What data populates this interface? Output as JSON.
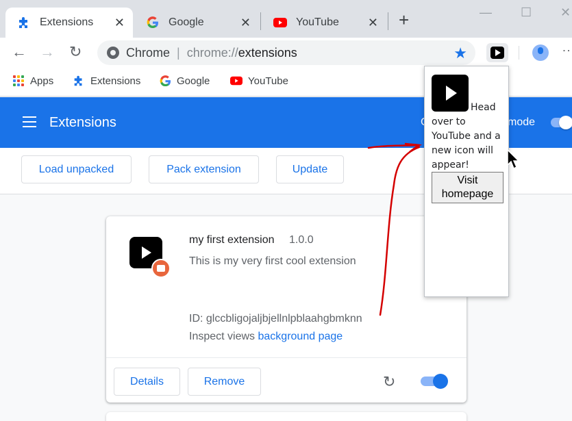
{
  "tabs": [
    {
      "label": "Extensions",
      "icon": "puzzle-icon"
    },
    {
      "label": "Google",
      "icon": "google-icon"
    },
    {
      "label": "YouTube",
      "icon": "youtube-icon"
    }
  ],
  "tab_close": "✕",
  "new_tab": "+",
  "window": {
    "minimize": "—",
    "maximize": "☐",
    "close": "✕"
  },
  "toolbar": {
    "back": "←",
    "forward": "→",
    "reload": "↻",
    "site_label": "Chrome",
    "url_scheme": "chrome://",
    "url_host": "extensions",
    "star": "★",
    "menu": "⋮"
  },
  "bookmarks": [
    {
      "label": "Apps"
    },
    {
      "label": "Extensions"
    },
    {
      "label": "Google"
    },
    {
      "label": "YouTube"
    }
  ],
  "header": {
    "title": "Extensions",
    "dev_mode_partial_left": "C",
    "dev_mode_partial_right": "mode"
  },
  "actions": {
    "load_unpacked": "Load unpacked",
    "pack_extension": "Pack extension",
    "update": "Update"
  },
  "extension": {
    "name": "my first extension",
    "version": "1.0.0",
    "description": "This is my very first cool extension",
    "id_label": "ID:",
    "id": "glccbligojaljbjellnlpblaahgbmknn",
    "inspect_label": "Inspect views",
    "inspect_link": "background page",
    "details": "Details",
    "remove": "Remove",
    "reload": "↻",
    "enabled": true
  },
  "popup": {
    "text": "Head over to YouTube and a new icon will appear!",
    "button": "Visit homepage"
  },
  "colors": {
    "accent": "#1a73e8",
    "youtube_red": "#ff0000",
    "annotation": "#d40000"
  }
}
